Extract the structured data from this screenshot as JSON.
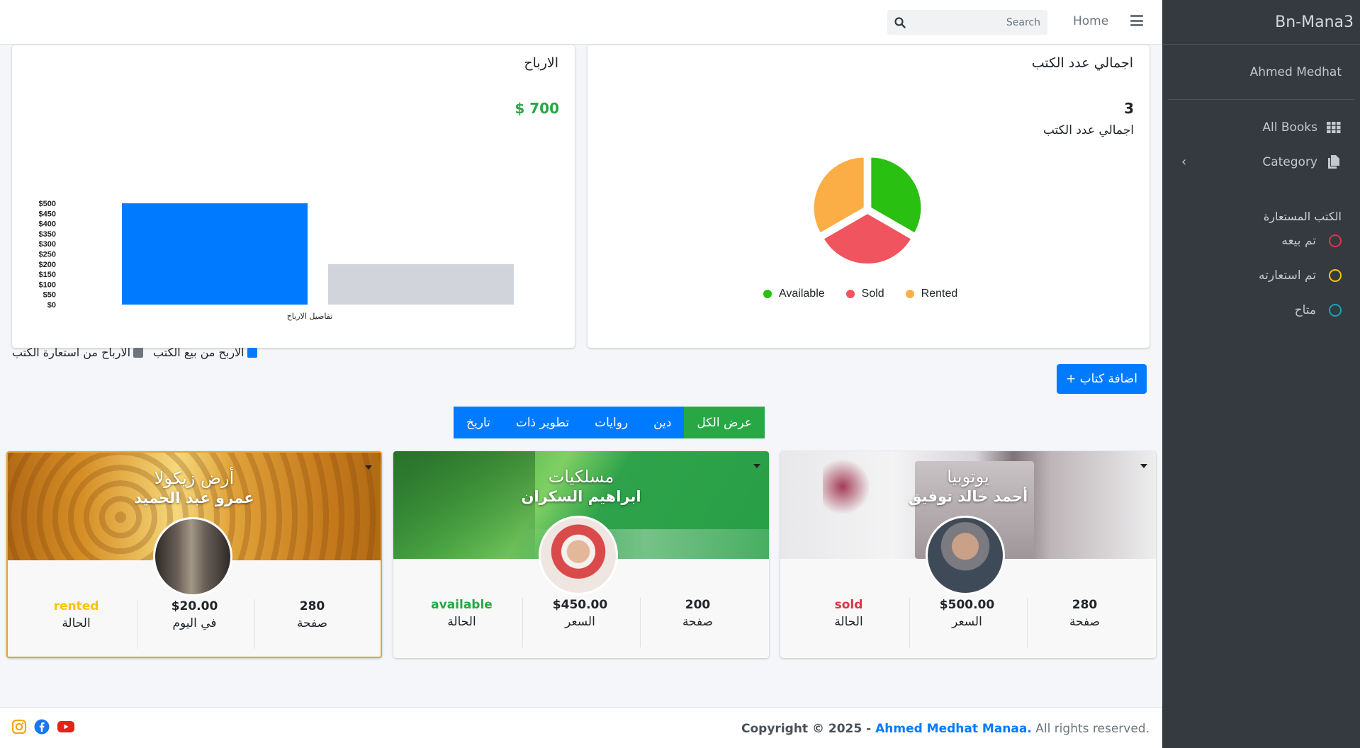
{
  "sidebar": {
    "brand": "Bn-Mana3",
    "user": "Ahmed Medhat",
    "items": [
      {
        "label": "All Books",
        "icon": "grid-icon"
      },
      {
        "label": "Category",
        "icon": "copy-icon"
      }
    ],
    "header": "الكتب المستعارة",
    "status_items": [
      {
        "label": "تم بيعه",
        "color": "#dc3545"
      },
      {
        "label": "تم استعارته",
        "color": "#ffc107"
      },
      {
        "label": "متاح",
        "color": "#17a2b8"
      }
    ]
  },
  "navbar": {
    "home": "Home",
    "search_placeholder": "Search"
  },
  "books_card": {
    "title": "اجمالي عدد الكتب",
    "count": "3",
    "count_label": "اجمالي عدد الكتب",
    "legend": [
      {
        "label": "Available",
        "color": "#2ac012"
      },
      {
        "label": "Sold",
        "color": "#f0545f"
      },
      {
        "label": "Rented",
        "color": "#fbae45"
      }
    ]
  },
  "profit_card": {
    "title": "الارباح",
    "total": "$ 700",
    "legend": [
      {
        "label": "الاربح من بيع الكتب",
        "color": "#007bff"
      },
      {
        "label": "الارباح من استعارة الكتب",
        "color": "#6c757d"
      }
    ]
  },
  "chart_data": [
    {
      "type": "pie",
      "categories": [
        "Available",
        "Sold",
        "Rented"
      ],
      "values": [
        1,
        1,
        1
      ],
      "colors": [
        "#2ac012",
        "#f0545f",
        "#fbae45"
      ],
      "legend": "bottom"
    },
    {
      "type": "bar",
      "categories": [
        "تفاصيل الارباح"
      ],
      "series": [
        {
          "name": "الاربح من بيع الكتب",
          "values": [
            500
          ],
          "color": "#007bff"
        },
        {
          "name": "الارباح من استعارة الكتب",
          "values": [
            200
          ],
          "color": "#d1d5db"
        }
      ],
      "xlabel": "تفاصيل الارباح",
      "ylim": [
        0,
        500
      ],
      "yticks": [
        "$500",
        "$450",
        "$400",
        "$350",
        "$300",
        "$250",
        "$200",
        "$150",
        "$100",
        "$50",
        "$0"
      ],
      "grid": false
    }
  ],
  "add_button": "+ اضافة كتاب",
  "tabs": [
    "عرض الكل",
    "دين",
    "روايات",
    "تطوير ذات",
    "تاريخ"
  ],
  "books": [
    {
      "title": "يوتوبيا",
      "author": "أحمد خالد توفيق",
      "pages": "280",
      "pages_label": "صفحة",
      "price": "$500.00",
      "price_label": "السعر",
      "status": "sold",
      "status_label": "الحالة",
      "status_color": "#dc3545"
    },
    {
      "title": "مسلكيات",
      "author": "ابراهيم السكران",
      "pages": "200",
      "pages_label": "صفحة",
      "price": "$450.00",
      "price_label": "السعر",
      "status": "available",
      "status_label": "الحالة",
      "status_color": "#28a745"
    },
    {
      "title": "أرض زيكولا",
      "author": "عمرو عبد الحميد",
      "pages": "280",
      "pages_label": "صفحة",
      "price": "$20.00",
      "price_label": "في اليوم",
      "status": "rented",
      "status_label": "الحالة",
      "status_color": "#ffc107"
    }
  ],
  "footer": {
    "copyright_prefix": "Copyright © 2025 - ",
    "copyright_name": "Ahmed Medhat Manaa.",
    "copyright_suffix": " All rights reserved.",
    "social": [
      "instagram-icon",
      "facebook-icon",
      "youtube-icon"
    ]
  }
}
